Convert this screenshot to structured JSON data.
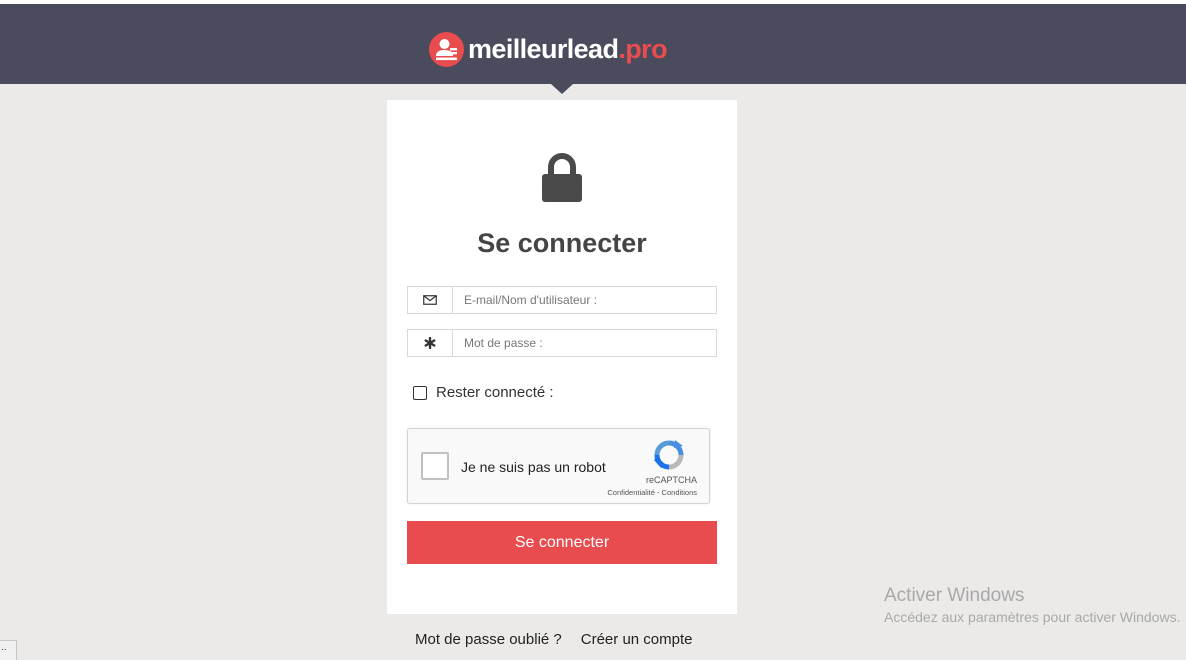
{
  "header": {
    "logo_name": "meilleurlead",
    "logo_tld": ".pro",
    "background_color": "#4b4b5e",
    "accent_color": "#e84c4f"
  },
  "login": {
    "lock_icon": "lock-icon",
    "title": "Se connecter",
    "email": {
      "icon": "envelope-icon",
      "placeholder": "E-mail/Nom d'utilisateur :",
      "value": ""
    },
    "password": {
      "icon": "asterisk-icon",
      "placeholder": "Mot de passe :",
      "value": ""
    },
    "remember_label": "Rester connecté :",
    "remember_checked": false,
    "recaptcha": {
      "label": "Je ne suis pas un robot",
      "brand": "reCAPTCHA",
      "links": "Confidentialité - Conditions"
    },
    "submit_label": "Se connecter"
  },
  "footer": {
    "forgot_password": "Mot de passe oublié ?",
    "create_account": "Créer un compte"
  },
  "watermark": {
    "title": "Activer Windows",
    "subtitle": "Accédez aux paramètres pour activer Windows."
  },
  "corner_tab": {
    "label": ".."
  }
}
